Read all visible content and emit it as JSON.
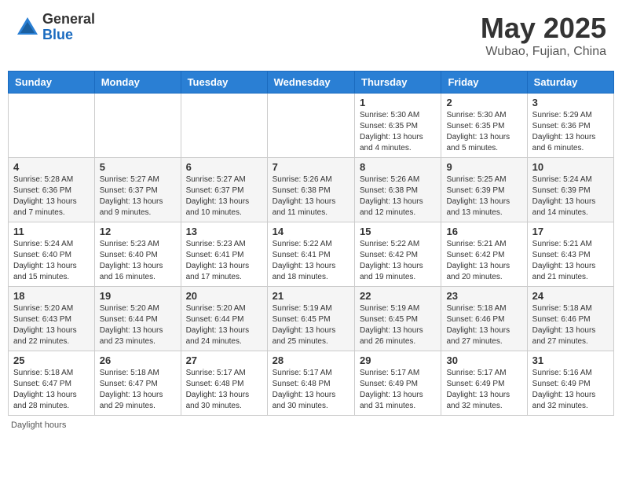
{
  "header": {
    "logo_general": "General",
    "logo_blue": "Blue",
    "month": "May 2025",
    "location": "Wubao, Fujian, China"
  },
  "days_of_week": [
    "Sunday",
    "Monday",
    "Tuesday",
    "Wednesday",
    "Thursday",
    "Friday",
    "Saturday"
  ],
  "weeks": [
    [
      {
        "day": "",
        "info": ""
      },
      {
        "day": "",
        "info": ""
      },
      {
        "day": "",
        "info": ""
      },
      {
        "day": "",
        "info": ""
      },
      {
        "day": "1",
        "info": "Sunrise: 5:30 AM\nSunset: 6:35 PM\nDaylight: 13 hours\nand 4 minutes."
      },
      {
        "day": "2",
        "info": "Sunrise: 5:30 AM\nSunset: 6:35 PM\nDaylight: 13 hours\nand 5 minutes."
      },
      {
        "day": "3",
        "info": "Sunrise: 5:29 AM\nSunset: 6:36 PM\nDaylight: 13 hours\nand 6 minutes."
      }
    ],
    [
      {
        "day": "4",
        "info": "Sunrise: 5:28 AM\nSunset: 6:36 PM\nDaylight: 13 hours\nand 7 minutes."
      },
      {
        "day": "5",
        "info": "Sunrise: 5:27 AM\nSunset: 6:37 PM\nDaylight: 13 hours\nand 9 minutes."
      },
      {
        "day": "6",
        "info": "Sunrise: 5:27 AM\nSunset: 6:37 PM\nDaylight: 13 hours\nand 10 minutes."
      },
      {
        "day": "7",
        "info": "Sunrise: 5:26 AM\nSunset: 6:38 PM\nDaylight: 13 hours\nand 11 minutes."
      },
      {
        "day": "8",
        "info": "Sunrise: 5:26 AM\nSunset: 6:38 PM\nDaylight: 13 hours\nand 12 minutes."
      },
      {
        "day": "9",
        "info": "Sunrise: 5:25 AM\nSunset: 6:39 PM\nDaylight: 13 hours\nand 13 minutes."
      },
      {
        "day": "10",
        "info": "Sunrise: 5:24 AM\nSunset: 6:39 PM\nDaylight: 13 hours\nand 14 minutes."
      }
    ],
    [
      {
        "day": "11",
        "info": "Sunrise: 5:24 AM\nSunset: 6:40 PM\nDaylight: 13 hours\nand 15 minutes."
      },
      {
        "day": "12",
        "info": "Sunrise: 5:23 AM\nSunset: 6:40 PM\nDaylight: 13 hours\nand 16 minutes."
      },
      {
        "day": "13",
        "info": "Sunrise: 5:23 AM\nSunset: 6:41 PM\nDaylight: 13 hours\nand 17 minutes."
      },
      {
        "day": "14",
        "info": "Sunrise: 5:22 AM\nSunset: 6:41 PM\nDaylight: 13 hours\nand 18 minutes."
      },
      {
        "day": "15",
        "info": "Sunrise: 5:22 AM\nSunset: 6:42 PM\nDaylight: 13 hours\nand 19 minutes."
      },
      {
        "day": "16",
        "info": "Sunrise: 5:21 AM\nSunset: 6:42 PM\nDaylight: 13 hours\nand 20 minutes."
      },
      {
        "day": "17",
        "info": "Sunrise: 5:21 AM\nSunset: 6:43 PM\nDaylight: 13 hours\nand 21 minutes."
      }
    ],
    [
      {
        "day": "18",
        "info": "Sunrise: 5:20 AM\nSunset: 6:43 PM\nDaylight: 13 hours\nand 22 minutes."
      },
      {
        "day": "19",
        "info": "Sunrise: 5:20 AM\nSunset: 6:44 PM\nDaylight: 13 hours\nand 23 minutes."
      },
      {
        "day": "20",
        "info": "Sunrise: 5:20 AM\nSunset: 6:44 PM\nDaylight: 13 hours\nand 24 minutes."
      },
      {
        "day": "21",
        "info": "Sunrise: 5:19 AM\nSunset: 6:45 PM\nDaylight: 13 hours\nand 25 minutes."
      },
      {
        "day": "22",
        "info": "Sunrise: 5:19 AM\nSunset: 6:45 PM\nDaylight: 13 hours\nand 26 minutes."
      },
      {
        "day": "23",
        "info": "Sunrise: 5:18 AM\nSunset: 6:46 PM\nDaylight: 13 hours\nand 27 minutes."
      },
      {
        "day": "24",
        "info": "Sunrise: 5:18 AM\nSunset: 6:46 PM\nDaylight: 13 hours\nand 27 minutes."
      }
    ],
    [
      {
        "day": "25",
        "info": "Sunrise: 5:18 AM\nSunset: 6:47 PM\nDaylight: 13 hours\nand 28 minutes."
      },
      {
        "day": "26",
        "info": "Sunrise: 5:18 AM\nSunset: 6:47 PM\nDaylight: 13 hours\nand 29 minutes."
      },
      {
        "day": "27",
        "info": "Sunrise: 5:17 AM\nSunset: 6:48 PM\nDaylight: 13 hours\nand 30 minutes."
      },
      {
        "day": "28",
        "info": "Sunrise: 5:17 AM\nSunset: 6:48 PM\nDaylight: 13 hours\nand 30 minutes."
      },
      {
        "day": "29",
        "info": "Sunrise: 5:17 AM\nSunset: 6:49 PM\nDaylight: 13 hours\nand 31 minutes."
      },
      {
        "day": "30",
        "info": "Sunrise: 5:17 AM\nSunset: 6:49 PM\nDaylight: 13 hours\nand 32 minutes."
      },
      {
        "day": "31",
        "info": "Sunrise: 5:16 AM\nSunset: 6:49 PM\nDaylight: 13 hours\nand 32 minutes."
      }
    ]
  ],
  "footer": {
    "daylight_label": "Daylight hours"
  }
}
